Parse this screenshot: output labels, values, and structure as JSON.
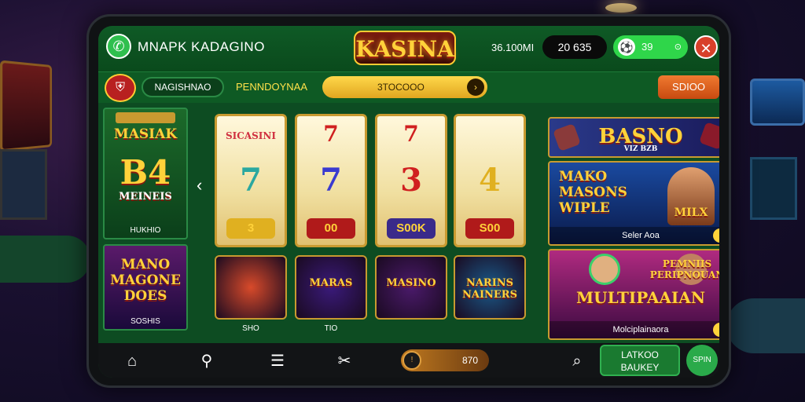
{
  "header": {
    "app_title": "MNAPK KADAGINO",
    "logo": "KASINA",
    "balance_text": "36.100MI",
    "balance_pill": "20 635",
    "coin_pill": "39",
    "close_icon": "✕"
  },
  "navbar": {
    "badge_icon": "shield-icon",
    "pill_label": "NAGISHNAO",
    "link_label": "PENNDOYNAA",
    "search_text": "3TOCOOO",
    "right_button": "SDIOO"
  },
  "left_column": {
    "card1_top": "MASIAK",
    "card1_mid": "B4",
    "card1_sub": "MEINEIS",
    "card1_label": "HUKHIO",
    "card2_title": "MANO MAGONE DOES",
    "card2_label": "SOSHIS"
  },
  "reels": [
    {
      "top": "SICASINI",
      "mid": "7",
      "pill": "3",
      "top_color": "#d03040",
      "mid_color": "#2aa8a0",
      "pill_bg": "#e0b020"
    },
    {
      "top": "7",
      "mid": "7",
      "pill": "00",
      "top_color": "#d02020",
      "mid_color": "#3a3ad0",
      "pill_bg": "#b01a1a"
    },
    {
      "top": "7",
      "mid": "3",
      "pill": "S00K",
      "top_color": "#d02020",
      "mid_color": "#d02020",
      "pill_bg": "#3a2a8a"
    },
    {
      "top": "",
      "mid": "4",
      "pill": "S00",
      "top_color": "#c89a30",
      "mid_color": "#e0b020",
      "pill_bg": "#b01a1a"
    }
  ],
  "tiles": [
    {
      "title": "",
      "label": "SHO",
      "bg": "#d84a2a"
    },
    {
      "title": "MARAS",
      "label": "TIO",
      "bg": "#3a1a7a"
    },
    {
      "title": "MASINO",
      "label": "",
      "bg": "#4a1a6a"
    },
    {
      "title": "NARINS NAINERS",
      "label": "",
      "bg": "#1a5a8a"
    }
  ],
  "right_column": {
    "card1_title": "BASNO",
    "card1_sub": "VIZ BZB",
    "card2_title": "MAKO MASONS WIPLE",
    "card2_side": "MILX",
    "card2_foot": "Seler Aoa",
    "card3_title": "MULTIPAAIAN",
    "card3_side": "PEMNIIS PERIPNOUAN",
    "card3_foot": "Molciplainaora"
  },
  "bottom_nav": {
    "slider_value": "870",
    "cta_label": "LATKOO BAUKEY",
    "round_label": "SPIN"
  }
}
